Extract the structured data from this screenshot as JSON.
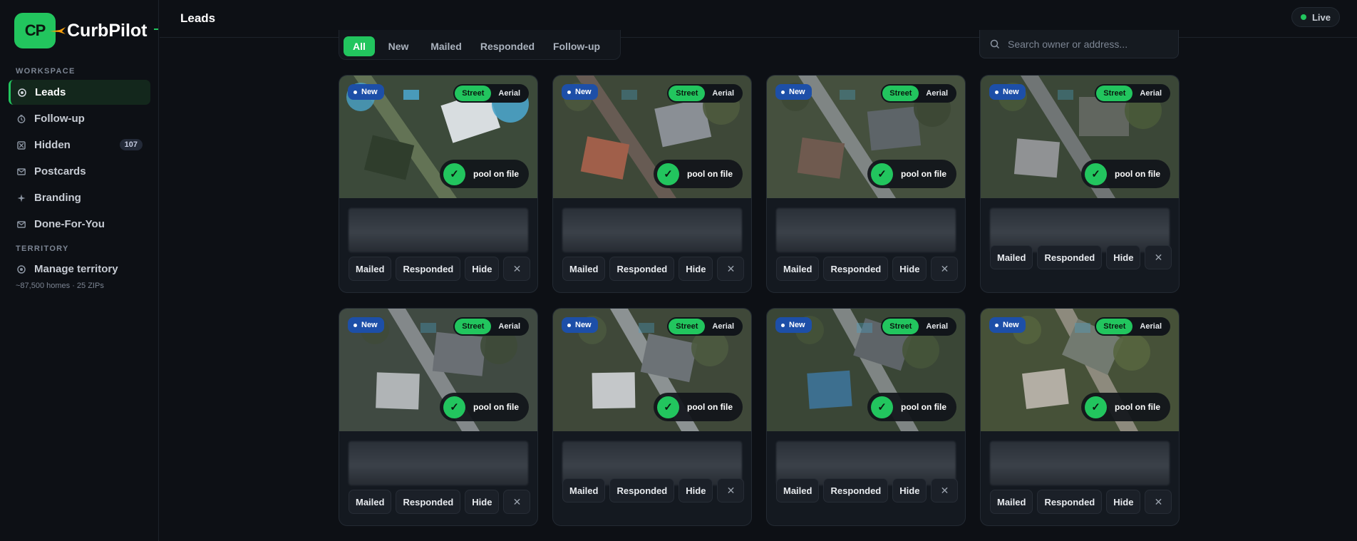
{
  "app": {
    "brand": "CurbPilot",
    "logo_initials": "CP"
  },
  "sidebar": {
    "workspace_label": "WORKSPACE",
    "items": [
      {
        "label": "Leads",
        "icon": "eye-icon",
        "active": true
      },
      {
        "label": "Follow-up",
        "icon": "clock-icon"
      },
      {
        "label": "Hidden",
        "icon": "hidden-box-icon",
        "count": "107"
      },
      {
        "label": "Postcards",
        "icon": "mail-icon"
      },
      {
        "label": "Branding",
        "icon": "sparkle-icon"
      },
      {
        "label": "Done-For-You",
        "icon": "mail-icon"
      }
    ],
    "territory_label": "TERRITORY",
    "territory_item": {
      "label": "Manage territory",
      "icon": "target-icon"
    },
    "territory_sub": "~87,500 homes · 25 ZIPs"
  },
  "header": {
    "title": "Leads",
    "status": "Live"
  },
  "filters": {
    "tabs": [
      "All",
      "New",
      "Mailed",
      "Responded",
      "Follow-up"
    ],
    "active": "All"
  },
  "search": {
    "placeholder": "Search owner or address..."
  },
  "card_labels": {
    "badge": "New",
    "street": "Street",
    "aerial": "Aerial",
    "pool": "pool on file",
    "mailed": "Mailed",
    "responded": "Responded",
    "hide": "Hide",
    "dismiss": "✕"
  },
  "cards": [
    {
      "status": "New",
      "view": "Street",
      "pool": "pool on file"
    },
    {
      "status": "New",
      "view": "Street",
      "pool": "pool on file"
    },
    {
      "status": "New",
      "view": "Street",
      "pool": "pool on file"
    },
    {
      "status": "New",
      "view": "Street",
      "pool": "pool on file"
    },
    {
      "status": "New",
      "view": "Street",
      "pool": "pool on file"
    },
    {
      "status": "New",
      "view": "Street",
      "pool": "pool on file"
    },
    {
      "status": "New",
      "view": "Street",
      "pool": "pool on file"
    },
    {
      "status": "New",
      "view": "Street",
      "pool": "pool on file"
    }
  ],
  "colors": {
    "accent": "#22c55e",
    "badge_blue": "#1d4fa8",
    "background": "#0d1015",
    "card": "#141920"
  }
}
